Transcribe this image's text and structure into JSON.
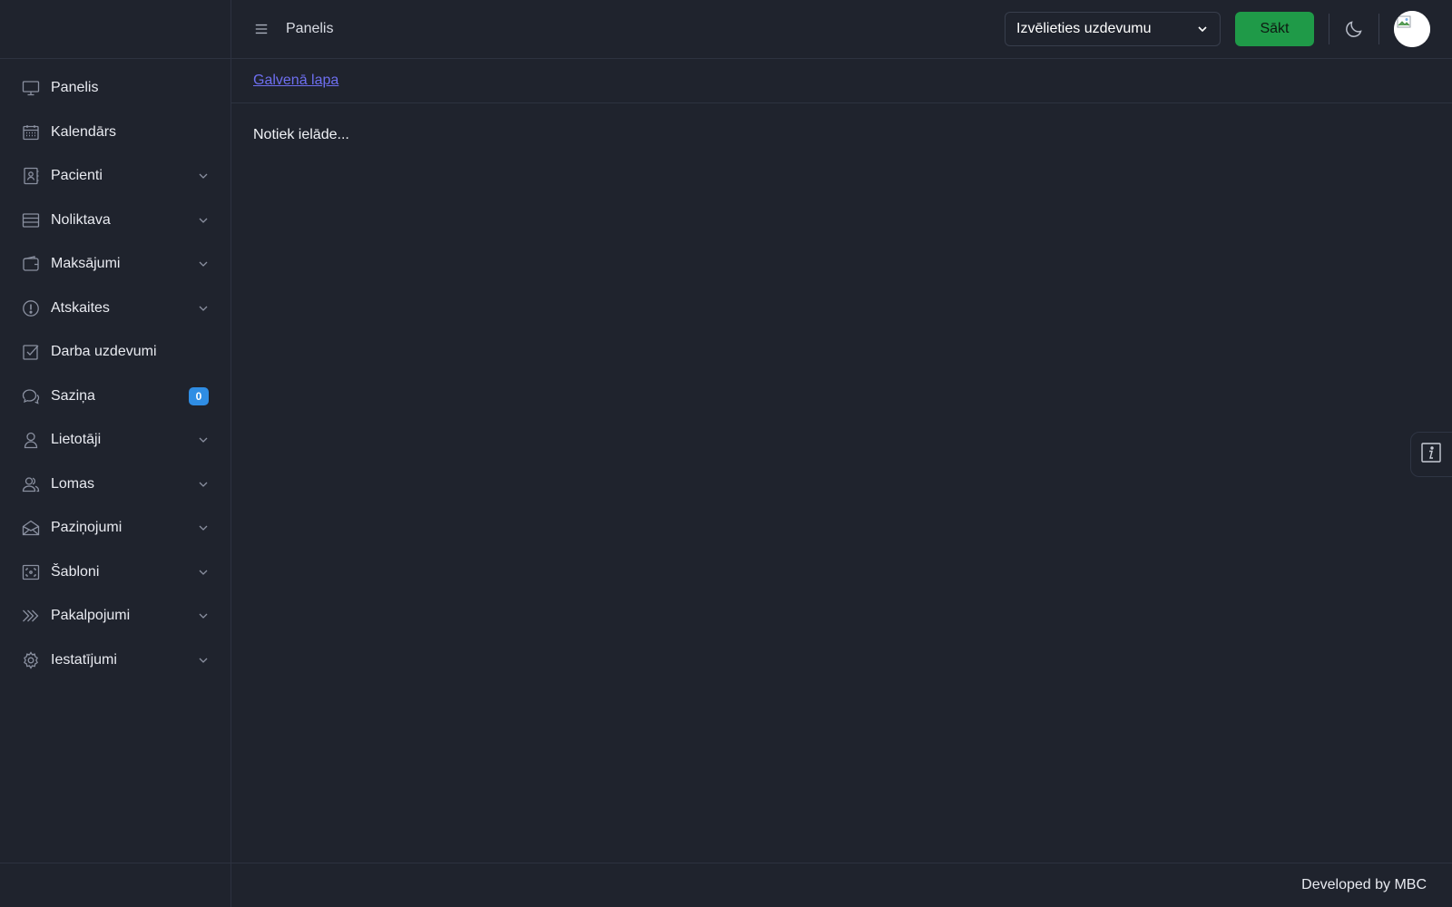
{
  "topbar": {
    "title": "Panelis",
    "task_select": {
      "value": "Izvēlieties uzdevumu"
    },
    "start_label": "Sākt"
  },
  "breadcrumb": {
    "home_label": "Galvenā lapa"
  },
  "main": {
    "loading_text": "Notiek ielāde..."
  },
  "footer": {
    "text": "Developed by MBC"
  },
  "sidebar": {
    "items": [
      {
        "label": "Panelis",
        "icon": "monitor-icon",
        "expandable": false
      },
      {
        "label": "Kalendārs",
        "icon": "calendar-icon",
        "expandable": false
      },
      {
        "label": "Pacienti",
        "icon": "contact-book-icon",
        "expandable": true
      },
      {
        "label": "Noliktava",
        "icon": "warehouse-icon",
        "expandable": true
      },
      {
        "label": "Maksājumi",
        "icon": "wallet-icon",
        "expandable": true
      },
      {
        "label": "Atskaites",
        "icon": "alert-circle-icon",
        "expandable": true
      },
      {
        "label": "Darba uzdevumi",
        "icon": "checkbox-icon",
        "expandable": false
      },
      {
        "label": "Saziņa",
        "icon": "chat-icon",
        "expandable": false,
        "badge": "0"
      },
      {
        "label": "Lietotāji",
        "icon": "user-icon",
        "expandable": true
      },
      {
        "label": "Lomas",
        "icon": "users-icon",
        "expandable": true
      },
      {
        "label": "Paziņojumi",
        "icon": "envelope-icon",
        "expandable": true
      },
      {
        "label": "Šabloni",
        "icon": "template-icon",
        "expandable": true
      },
      {
        "label": "Pakalpojumi",
        "icon": "double-chevron-icon",
        "expandable": true
      },
      {
        "label": "Iestatījumi",
        "icon": "gear-icon",
        "expandable": true
      }
    ]
  },
  "colors": {
    "background": "#1f232d",
    "border": "#2d3240",
    "start_button": "#1f9a48",
    "badge": "#2f8de4",
    "link": "#6e6ff0"
  }
}
